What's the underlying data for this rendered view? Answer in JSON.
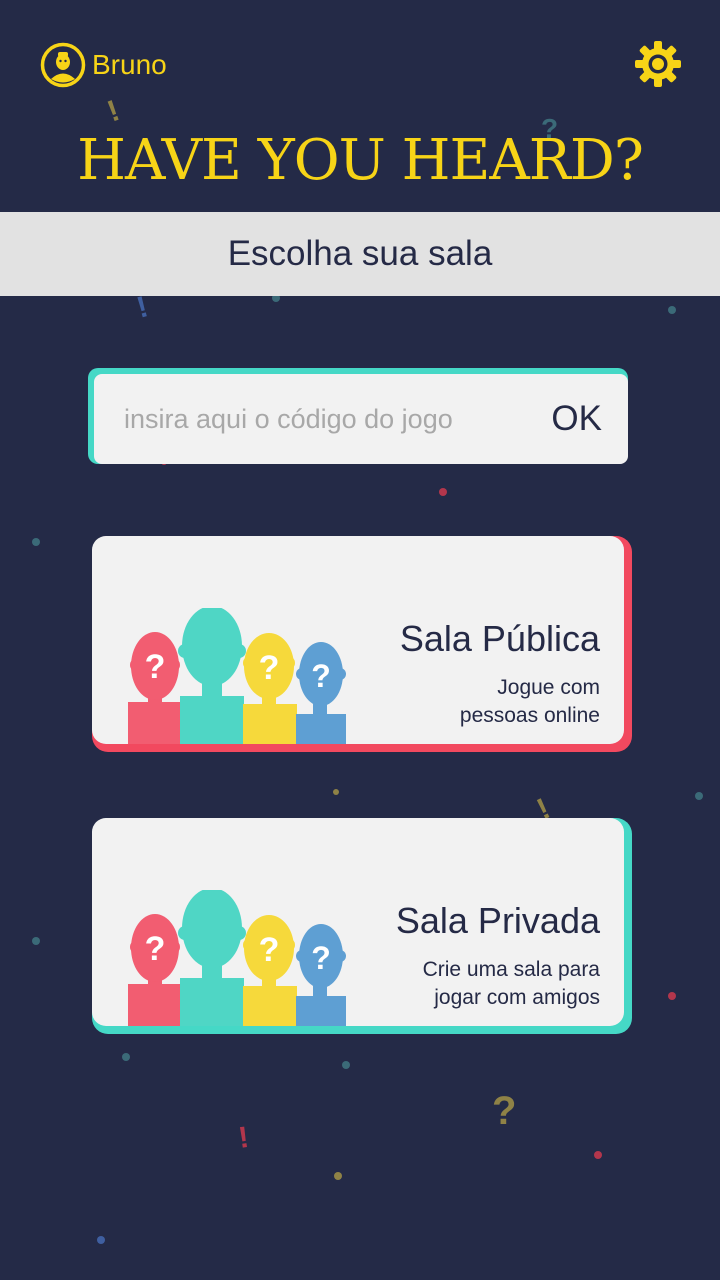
{
  "user": {
    "name": "Bruno",
    "avatar_icon": "user-avatar-icon"
  },
  "settings": {
    "icon": "gear-icon"
  },
  "title": "HAVE YOU HEARD?",
  "subtitle": "Escolha sua sala",
  "code_entry": {
    "placeholder": "insira aqui o código do jogo",
    "value": "",
    "ok_label": "OK"
  },
  "rooms": [
    {
      "title": "Sala Pública",
      "desc_line1": "Jogue com",
      "desc_line2": "pessoas online",
      "accent": "#f2495f"
    },
    {
      "title": "Sala Privada",
      "desc_line1": "Crie uma sala para",
      "desc_line2": "jogar com amigos",
      "accent": "#45d8c6"
    }
  ],
  "colors": {
    "background": "#242a47",
    "brand_yellow": "#f7d417",
    "teal": "#45d8c6",
    "red": "#f2495f",
    "blue": "#5e9fd3",
    "card": "#f2f2f2"
  }
}
